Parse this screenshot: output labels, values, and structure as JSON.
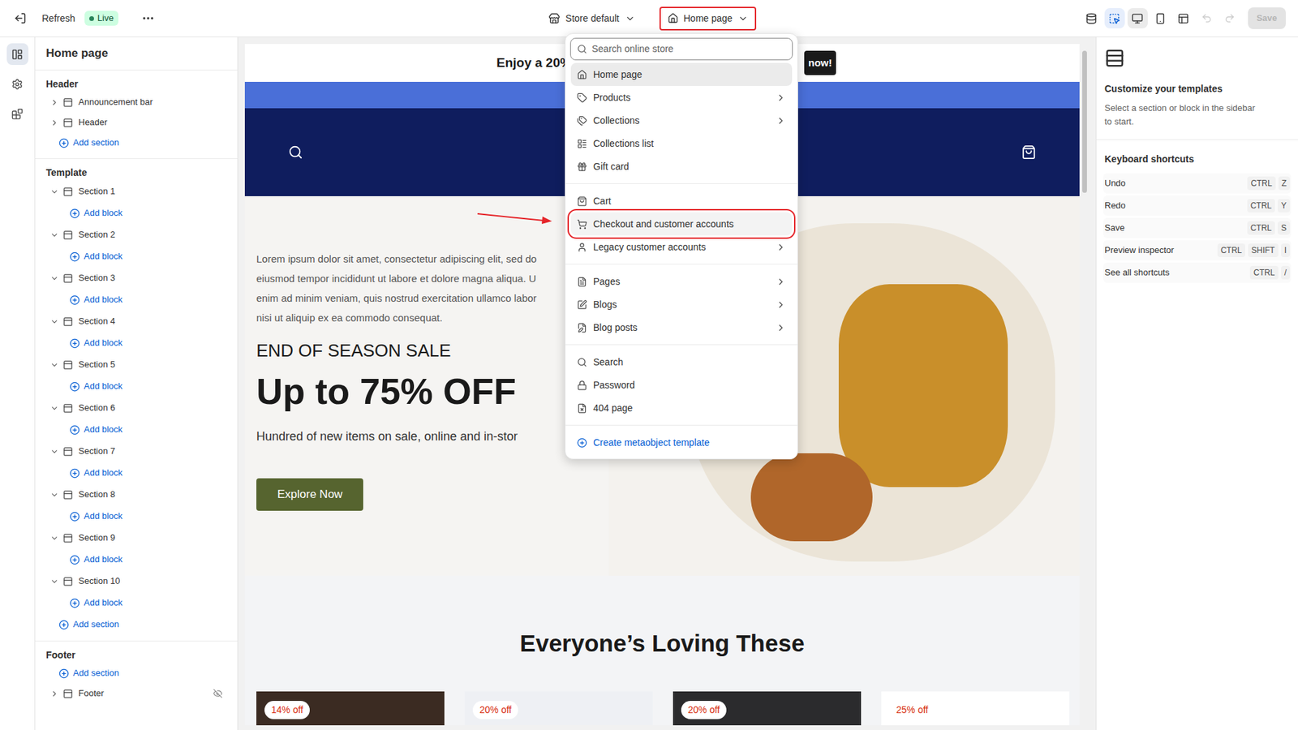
{
  "topbar": {
    "refresh": "Refresh",
    "status": "Live",
    "store": "Store default",
    "template": {
      "label": "Home page",
      "highlighted": true
    },
    "tools": [
      {
        "selected": false
      },
      {
        "selected": true
      },
      {
        "selected": true
      },
      {
        "selected": false
      },
      {
        "selected": false
      }
    ],
    "history": [
      {
        "disabled": true
      },
      {
        "disabled": true
      }
    ],
    "save": {
      "label": "Save",
      "disabled": true
    }
  },
  "rail": [
    {
      "selected": true
    },
    {
      "selected": false
    },
    {
      "selected": false
    }
  ],
  "sidebar": {
    "title": "Home page",
    "groups": [
      {
        "label": "Header",
        "rows": [
          {
            "kind": "item",
            "label": "Announcement bar",
            "expanded": false,
            "hidden": false
          },
          {
            "kind": "item",
            "label": "Header",
            "expanded": false,
            "hidden": false
          },
          {
            "kind": "add-section",
            "label": "Add section"
          }
        ]
      },
      {
        "label": "Template",
        "rows": [
          {
            "kind": "item",
            "label": "Section 1",
            "expanded": true,
            "hidden": false
          },
          {
            "kind": "add-block",
            "label": "Add block"
          },
          {
            "kind": "item",
            "label": "Section 2",
            "expanded": true,
            "hidden": false
          },
          {
            "kind": "add-block",
            "label": "Add block"
          },
          {
            "kind": "item",
            "label": "Section 3",
            "expanded": true,
            "hidden": false
          },
          {
            "kind": "add-block",
            "label": "Add block"
          },
          {
            "kind": "item",
            "label": "Section 4",
            "expanded": true,
            "hidden": false
          },
          {
            "kind": "add-block",
            "label": "Add block"
          },
          {
            "kind": "item",
            "label": "Section 5",
            "expanded": true,
            "hidden": false
          },
          {
            "kind": "add-block",
            "label": "Add block"
          },
          {
            "kind": "item",
            "label": "Section 6",
            "expanded": true,
            "hidden": false
          },
          {
            "kind": "add-block",
            "label": "Add block"
          },
          {
            "kind": "item",
            "label": "Section 7",
            "expanded": true,
            "hidden": false
          },
          {
            "kind": "add-block",
            "label": "Add block"
          },
          {
            "kind": "item",
            "label": "Section 8",
            "expanded": true,
            "hidden": false
          },
          {
            "kind": "add-block",
            "label": "Add block"
          },
          {
            "kind": "item",
            "label": "Section 9",
            "expanded": true,
            "hidden": false
          },
          {
            "kind": "add-block",
            "label": "Add block"
          },
          {
            "kind": "item",
            "label": "Section 10",
            "expanded": true,
            "hidden": false
          },
          {
            "kind": "add-block",
            "label": "Add block"
          },
          {
            "kind": "add-section",
            "label": "Add section"
          }
        ]
      },
      {
        "label": "Footer",
        "rows": [
          {
            "kind": "add-section",
            "label": "Add section"
          },
          {
            "kind": "item",
            "label": "Footer",
            "expanded": false,
            "hidden": true
          }
        ]
      }
    ]
  },
  "preview": {
    "announcement": {
      "text": "Enjoy a 20%",
      "button": "now!"
    },
    "hero": {
      "lines": [
        "Lorem ipsum dolor sit amet, consectetur adipiscing elit, sed do",
        "eiusmod tempor incididunt ut labore et dolore magna aliqua. U",
        "enim ad minim veniam, quis nostrud exercitation ullamco labor",
        "nisi ut aliquip ex ea commodo consequat."
      ],
      "eyebrow": "END OF SEASON SALE",
      "headline": "Up to 75% OFF",
      "subtitle": "Hundred of new items on sale, online and in-stor",
      "button": "Explore Now"
    },
    "featured": {
      "title": "Everyone’s Loving These",
      "products": [
        {
          "badge": "14% off"
        },
        {
          "badge": "20% off"
        },
        {
          "badge": "20% off"
        },
        {
          "badge": "25% off"
        }
      ]
    }
  },
  "menu": {
    "search_placeholder": "Search online store",
    "groups": [
      [
        {
          "label": "Home page",
          "submenu": false,
          "selected": true,
          "highlighted": false
        },
        {
          "label": "Products",
          "submenu": true,
          "selected": false,
          "highlighted": false
        },
        {
          "label": "Collections",
          "submenu": true,
          "selected": false,
          "highlighted": false
        },
        {
          "label": "Collections list",
          "submenu": false,
          "selected": false,
          "highlighted": false
        },
        {
          "label": "Gift card",
          "submenu": false,
          "selected": false,
          "highlighted": false
        }
      ],
      [
        {
          "label": "Cart",
          "submenu": false,
          "selected": false,
          "highlighted": false
        },
        {
          "label": "Checkout and customer accounts",
          "submenu": false,
          "selected": false,
          "highlighted": true
        },
        {
          "label": "Legacy customer accounts",
          "submenu": true,
          "selected": false,
          "highlighted": false
        }
      ],
      [
        {
          "label": "Pages",
          "submenu": true,
          "selected": false,
          "highlighted": false
        },
        {
          "label": "Blogs",
          "submenu": true,
          "selected": false,
          "highlighted": false
        },
        {
          "label": "Blog posts",
          "submenu": true,
          "selected": false,
          "highlighted": false
        }
      ],
      [
        {
          "label": "Search",
          "submenu": false,
          "selected": false,
          "highlighted": false
        },
        {
          "label": "Password",
          "submenu": false,
          "selected": false,
          "highlighted": false
        },
        {
          "label": "404 page",
          "submenu": false,
          "selected": false,
          "highlighted": false
        }
      ]
    ],
    "create": "Create metaobject template"
  },
  "panel": {
    "title": "Customize your templates",
    "description": [
      "Select a section or block in the sidebar",
      "to start."
    ],
    "shortcuts_title": "Keyboard shortcuts",
    "shortcuts": [
      {
        "label": "Undo",
        "keys": [
          "CTRL",
          "Z"
        ]
      },
      {
        "label": "Redo",
        "keys": [
          "CTRL",
          "Y"
        ]
      },
      {
        "label": "Save",
        "keys": [
          "CTRL",
          "S"
        ]
      },
      {
        "label": "Preview inspector",
        "keys": [
          "CTRL",
          "SHIFT",
          "I"
        ]
      },
      {
        "label": "See all shortcuts",
        "keys": [
          "CTRL",
          "/"
        ]
      }
    ]
  }
}
